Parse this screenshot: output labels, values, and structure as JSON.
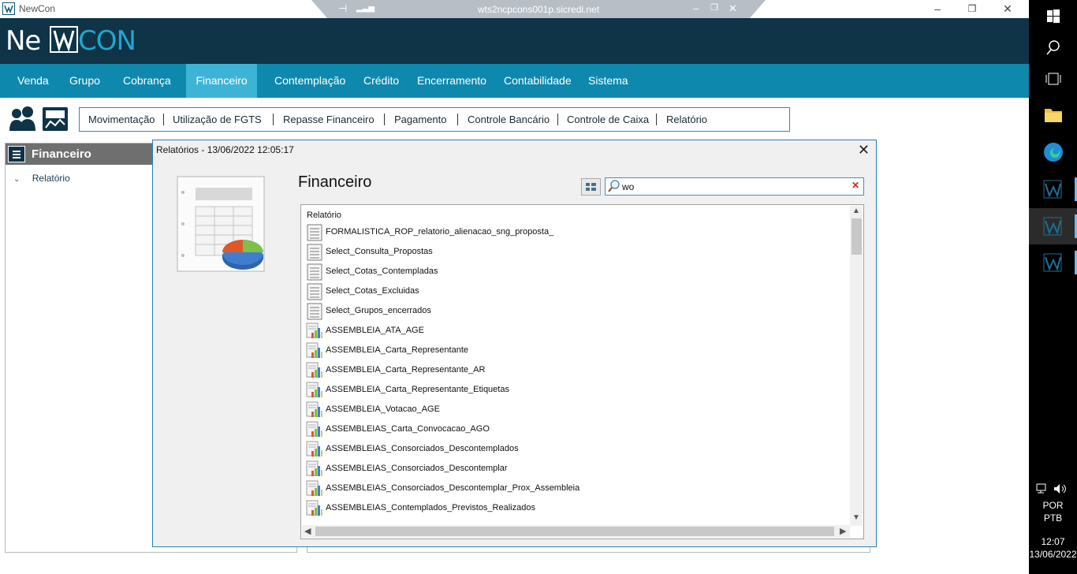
{
  "window": {
    "title": "NewCon",
    "rdp_host": "wts2ncpcons001p.sicredi.net"
  },
  "logo": {
    "part1": "Ne",
    "part2": "CON"
  },
  "menu": {
    "items": [
      {
        "label": "Venda"
      },
      {
        "label": "Grupo"
      },
      {
        "label": "Cobrança"
      },
      {
        "label": "Financeiro",
        "active": true
      },
      {
        "label": "Contemplação"
      },
      {
        "label": "Crédito"
      },
      {
        "label": "Encerramento"
      },
      {
        "label": "Contabilidade"
      },
      {
        "label": "Sistema"
      }
    ]
  },
  "submenu": {
    "items": [
      {
        "label": "Movimentação"
      },
      {
        "label": "Utilização de FGTS"
      },
      {
        "label": "Repasse Financeiro"
      },
      {
        "label": "Pagamento"
      },
      {
        "label": "Controle Bancário"
      },
      {
        "label": "Controle de Caixa"
      },
      {
        "label": "Relatório"
      }
    ]
  },
  "left_panel": {
    "title": "Financeiro",
    "tree": [
      {
        "label": "Relatório",
        "expanded": true
      }
    ]
  },
  "dialog": {
    "title": "Relatórios - 13/06/2022  12:05:17",
    "heading": "Financeiro",
    "search": {
      "value": "wo",
      "placeholder": ""
    },
    "column_header": "Relatório",
    "rows": [
      {
        "name": "FORMALISTICA_ROP_relatorio_alienacao_sng_proposta_",
        "type": "document"
      },
      {
        "name": "Select_Consulta_Propostas",
        "type": "document"
      },
      {
        "name": "Select_Cotas_Contempladas",
        "type": "document"
      },
      {
        "name": "Select_Cotas_Excluidas",
        "type": "document"
      },
      {
        "name": "Select_Grupos_encerrados",
        "type": "document"
      },
      {
        "name": "ASSEMBLEIA_ATA_AGE",
        "type": "chart"
      },
      {
        "name": "ASSEMBLEIA_Carta_Representante",
        "type": "chart"
      },
      {
        "name": "ASSEMBLEIA_Carta_Representante_AR",
        "type": "chart"
      },
      {
        "name": "ASSEMBLEIA_Carta_Representante_Etiquetas",
        "type": "chart"
      },
      {
        "name": "ASSEMBLEIA_Votacao_AGE",
        "type": "chart"
      },
      {
        "name": "ASSEMBLEIAS_Carta_Convocacao_AGO",
        "type": "chart"
      },
      {
        "name": "ASSEMBLEIAS_Consorciados_Descontemplados",
        "type": "chart"
      },
      {
        "name": "ASSEMBLEIAS_Consorciados_Descontemplar",
        "type": "chart"
      },
      {
        "name": "ASSEMBLEIAS_Consorciados_Descontemplar_Prox_Assembleia",
        "type": "chart"
      },
      {
        "name": "ASSEMBLEIAS_Contemplados_Previstos_Realizados",
        "type": "chart"
      }
    ]
  },
  "taskbar": {
    "lang1": "POR",
    "lang2": "PTB",
    "time": "12:07",
    "date": "13/06/2022"
  },
  "colors": {
    "header": "#0f3347",
    "menu": "#0e89ad",
    "menu_active": "#3db4d6",
    "accent": "#1fa6cf"
  }
}
